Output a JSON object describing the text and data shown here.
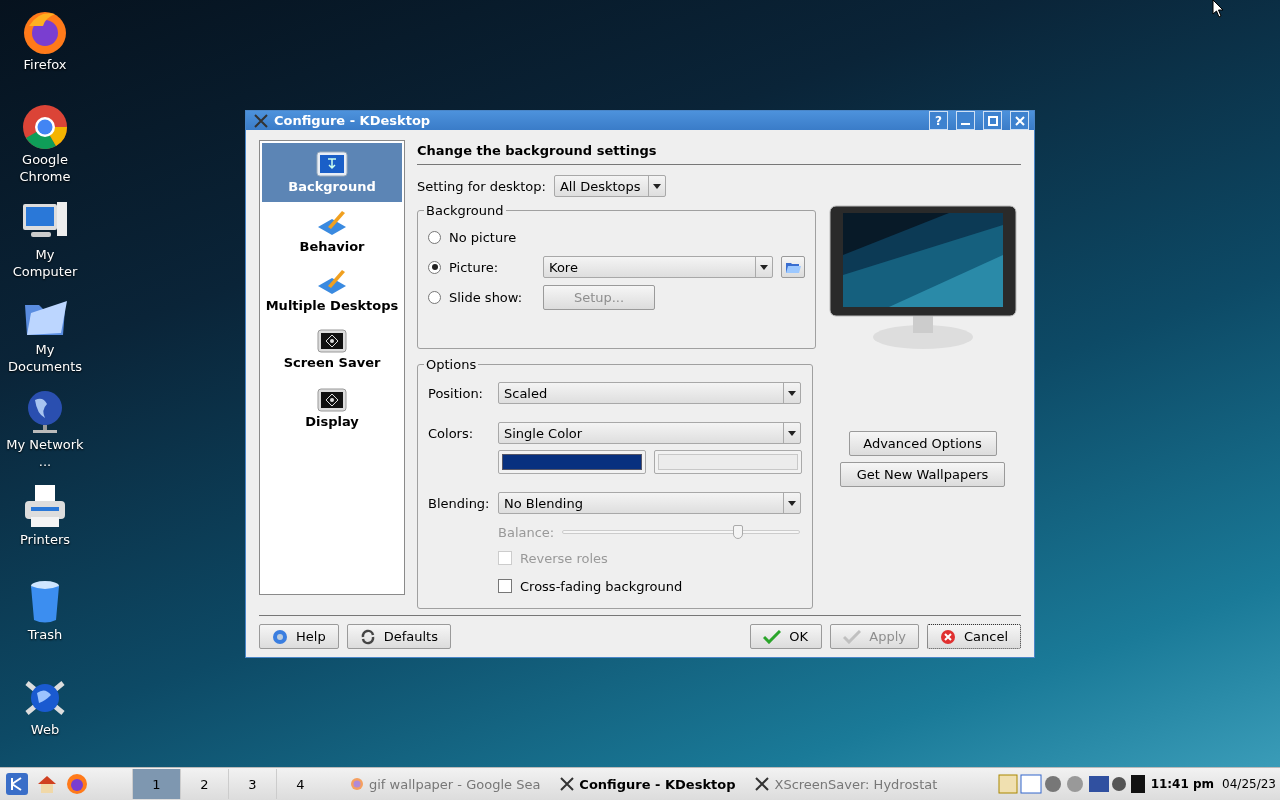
{
  "desktop_icons": [
    {
      "label": "Firefox",
      "kind": "firefox"
    },
    {
      "label": "Google Chrome",
      "kind": "chrome"
    },
    {
      "label": "My Computer",
      "kind": "computer"
    },
    {
      "label": "My Documents",
      "kind": "folder"
    },
    {
      "label": "My Network ...",
      "kind": "globe"
    },
    {
      "label": "Printers",
      "kind": "printer"
    },
    {
      "label": "Trash",
      "kind": "trash"
    },
    {
      "label": "Web",
      "kind": "web"
    }
  ],
  "window": {
    "title": "Configure - KDesktop",
    "help_button": "?"
  },
  "sidebar": {
    "items": [
      {
        "label": "Background",
        "kind": "screen",
        "selected": true
      },
      {
        "label": "Behavior",
        "kind": "pencil",
        "selected": false
      },
      {
        "label": "Multiple Desktops",
        "kind": "pencil",
        "selected": false
      },
      {
        "label": "Screen Saver",
        "kind": "saver",
        "selected": false
      },
      {
        "label": "Display",
        "kind": "saver",
        "selected": false
      }
    ]
  },
  "heading": "Change the background settings",
  "desktop_setting": {
    "label": "Setting for desktop:",
    "value": "All Desktops"
  },
  "background_group": {
    "title": "Background",
    "options": [
      {
        "label": "No picture",
        "selected": false
      },
      {
        "label": "Picture:",
        "selected": true
      },
      {
        "label": "Slide show:",
        "selected": false
      }
    ],
    "picture_value": "Kore",
    "setup_button": {
      "label": "Setup...",
      "disabled": true
    }
  },
  "options_group": {
    "title": "Options",
    "position": {
      "label": "Position:",
      "value": "Scaled"
    },
    "colors": {
      "label": "Colors:",
      "value": "Single Color"
    },
    "swatches": [
      {
        "color": "#08307f",
        "disabled": false
      },
      {
        "color": "#ececec",
        "disabled": true
      }
    ],
    "blending": {
      "label": "Blending:",
      "value": "No Blending"
    },
    "balance": {
      "label": "Balance:",
      "level": 0.74,
      "disabled": true
    },
    "checkboxes": [
      {
        "label": "Reverse roles",
        "checked": false,
        "disabled": true
      },
      {
        "label": "Cross-fading background",
        "checked": false,
        "disabled": false
      }
    ]
  },
  "side_buttons": [
    "Advanced Options",
    "Get New Wallpapers"
  ],
  "footer_buttons": [
    {
      "label": "Help",
      "kind": "help",
      "disabled": false
    },
    {
      "label": "Defaults",
      "kind": "defaults",
      "disabled": false
    },
    {
      "label": "OK",
      "kind": "ok",
      "disabled": false
    },
    {
      "label": "Apply",
      "kind": "apply",
      "disabled": true
    },
    {
      "label": "Cancel",
      "kind": "cancel",
      "disabled": false
    }
  ],
  "taskbar": {
    "pager": [
      {
        "label": "1",
        "selected": true
      },
      {
        "label": "2",
        "selected": false
      },
      {
        "label": "3",
        "selected": false
      },
      {
        "label": "4",
        "selected": false
      }
    ],
    "tasks": [
      {
        "label": "gif wallpaper - Google Sea",
        "kind": "firefox",
        "selected": false
      },
      {
        "label": "Configure - KDesktop",
        "kind": "x",
        "selected": true
      },
      {
        "label": "XScreenSaver: Hydrostat",
        "kind": "x",
        "selected": false
      }
    ],
    "clock": "11:41 pm",
    "date": "04/25/23"
  }
}
